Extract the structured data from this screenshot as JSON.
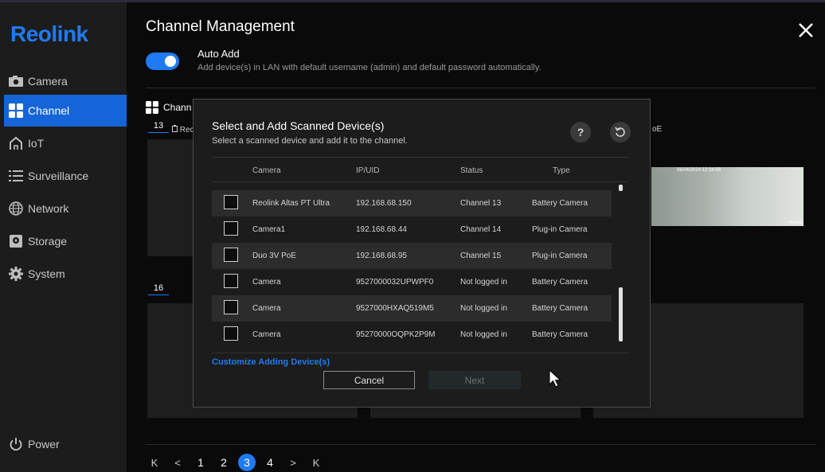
{
  "brand": {
    "logo_text": "Reolink",
    "accent": "#1f7bf2",
    "active_nav_bg": "#1565d8"
  },
  "sidebar": {
    "items": [
      {
        "label": "Camera",
        "icon": "camera-icon",
        "active": false
      },
      {
        "label": "Channel",
        "icon": "grid-icon",
        "active": true
      },
      {
        "label": "IoT",
        "icon": "home-icon",
        "active": false
      },
      {
        "label": "Surveillance",
        "icon": "list-icon",
        "active": false
      },
      {
        "label": "Network",
        "icon": "globe-icon",
        "active": false
      },
      {
        "label": "Storage",
        "icon": "storage-icon",
        "active": false
      },
      {
        "label": "System",
        "icon": "gear-icon",
        "active": false
      }
    ],
    "power_label": "Power"
  },
  "header": {
    "title": "Channel Management",
    "auto_add": {
      "title": "Auto Add",
      "description": "Add device(s) in LAN with default username (admin) and default password automatically.",
      "enabled": true
    }
  },
  "channels": {
    "section_label": "Chann",
    "tiles": [
      {
        "number": "13",
        "label": "Rec"
      },
      {
        "number": "16",
        "label": ""
      }
    ],
    "poe_label": "oE",
    "preview_timestamp": "06/04/2024 12:34:56",
    "preview_logo": "Reolink"
  },
  "modal": {
    "title": "Select and Add Scanned Device(s)",
    "subtitle": "Select a scanned device and add it to the channel.",
    "columns": [
      "Camera",
      "IP/UID",
      "Status",
      "Type"
    ],
    "rows": [
      {
        "camera": "Reolink Altas PT Ultra",
        "ip": "192.168.68.150",
        "status": "Channel 13",
        "type": "Battery Camera"
      },
      {
        "camera": "Camera1",
        "ip": "192.168.68.44",
        "status": "Channel 14",
        "type": "Plug-in Camera"
      },
      {
        "camera": "Duo 3V PoE",
        "ip": "192.168.68.95",
        "status": "Channel 15",
        "type": "Plug-in Camera"
      },
      {
        "camera": "Camera",
        "ip": "9527000032UPWPF0",
        "status": "Not logged in",
        "type": "Battery Camera"
      },
      {
        "camera": "Camera",
        "ip": "9527000HXAQ519M5",
        "status": "Not logged in",
        "type": "Battery Camera"
      },
      {
        "camera": "Camera",
        "ip": "95270000OQPK2P9M",
        "status": "Not logged in",
        "type": "Battery Camera"
      }
    ],
    "customize_label": "Customize Adding Device(s)",
    "cancel_label": "Cancel",
    "next_label": "Next",
    "help_label": "?"
  },
  "pagination": {
    "first": "K",
    "prev": "<",
    "pages": [
      "1",
      "2",
      "3",
      "4"
    ],
    "current": "3",
    "next": ">",
    "last": "K"
  }
}
